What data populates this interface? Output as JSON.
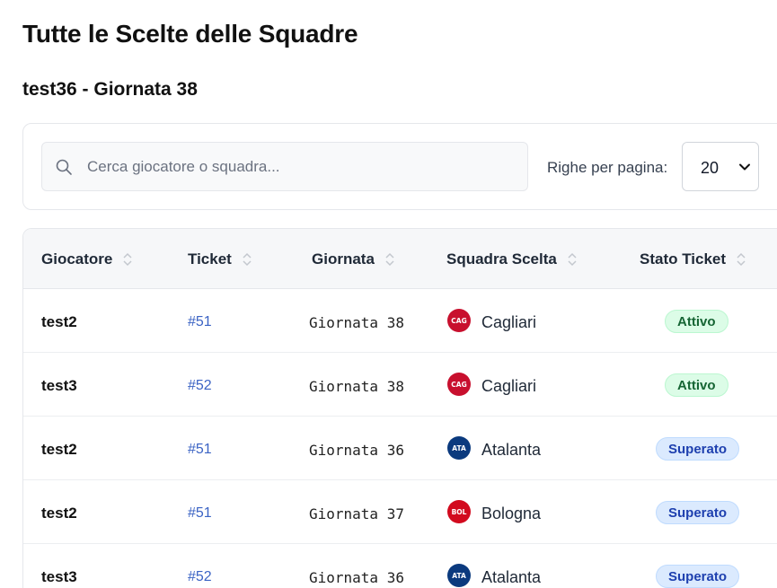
{
  "page": {
    "title": "Tutte le Scelte delle Squadre",
    "subtitle": "test36 - Giornata 38"
  },
  "filters": {
    "search_placeholder": "Cerca giocatore o squadra...",
    "search_value": "",
    "rows_label": "Righe per pagina:",
    "rows_value": "20",
    "icons": {
      "search": "search-icon",
      "select": "chevron-down-icon"
    }
  },
  "table": {
    "headers": [
      "Giocatore",
      "Ticket",
      "Giornata",
      "Squadra Scelta",
      "Stato Ticket"
    ],
    "sort_icon": "sort-updown-icon",
    "rows": [
      {
        "player": "test2",
        "ticket": "#51",
        "round": "Giornata 38",
        "team": "Cagliari",
        "team_abbr": "CAG",
        "team_color": "#c8102e",
        "status": "Attivo",
        "status_kind": "active"
      },
      {
        "player": "test3",
        "ticket": "#52",
        "round": "Giornata 38",
        "team": "Cagliari",
        "team_abbr": "CAG",
        "team_color": "#c8102e",
        "status": "Attivo",
        "status_kind": "active"
      },
      {
        "player": "test2",
        "ticket": "#51",
        "round": "Giornata 36",
        "team": "Atalanta",
        "team_abbr": "ATA",
        "team_color": "#0b3a7e",
        "status": "Superato",
        "status_kind": "passed"
      },
      {
        "player": "test2",
        "ticket": "#51",
        "round": "Giornata 37",
        "team": "Bologna",
        "team_abbr": "BOL",
        "team_color": "#d20a1e",
        "status": "Superato",
        "status_kind": "passed"
      },
      {
        "player": "test3",
        "ticket": "#52",
        "round": "Giornata 36",
        "team": "Atalanta",
        "team_abbr": "ATA",
        "team_color": "#0b3a7e",
        "status": "Superato",
        "status_kind": "passed"
      }
    ]
  },
  "colors": {
    "link": "#3b63c4",
    "badge_active_bg": "#dcfce7",
    "badge_active_text": "#166534",
    "badge_passed_bg": "#dbeafe",
    "badge_passed_text": "#1e40af"
  }
}
